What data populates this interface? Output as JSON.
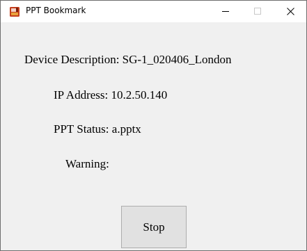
{
  "window": {
    "title": "PPT Bookmark"
  },
  "titlebar_icons": {
    "app": "powerpoint-bookmark-icon",
    "minimize": "minimize-icon",
    "maximize": "maximize-icon",
    "close": "close-icon"
  },
  "fields": {
    "device_description": "Device Description: SG-1_020406_London",
    "ip_address": "IP Address: 10.2.50.140",
    "ppt_status": "PPT Status: a.pptx",
    "warning": "Warning:"
  },
  "actions": {
    "stop_label": "Stop"
  },
  "colors": {
    "window_bg": "#f0f0f0",
    "titlebar_bg": "#ffffff",
    "button_bg": "#e1e1e1",
    "button_border": "#adadad",
    "icon_red": "#c43e1c",
    "icon_orange": "#e8a33c"
  }
}
